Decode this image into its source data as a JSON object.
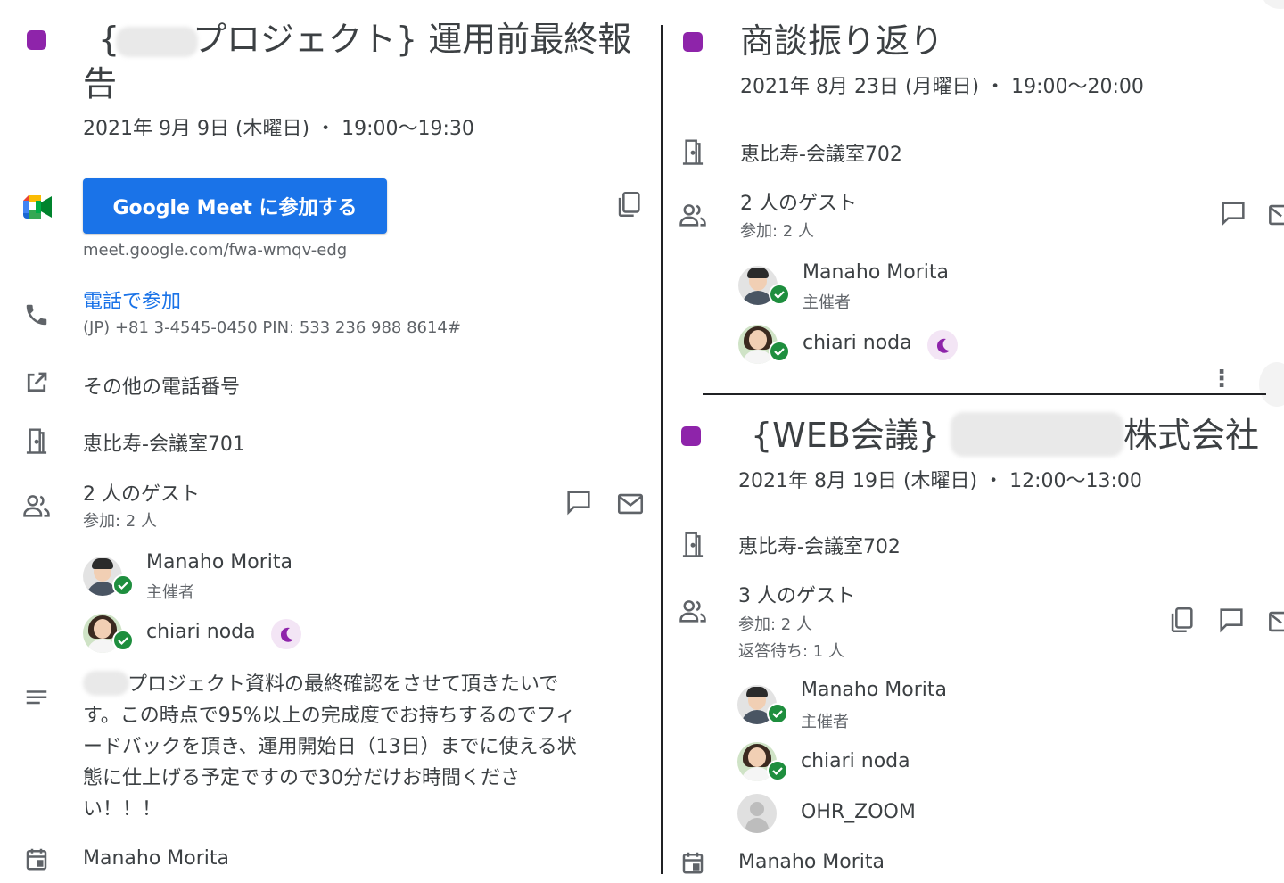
{
  "left": {
    "title_part1": "{",
    "title_part2": "プロジェクト} 運用前最終報",
    "title_line2": "告",
    "date": "2021年 9月 9日 (木曜日) ・ 19:00～19:30",
    "meet_button": "Google Meet に参加する",
    "meet_url": "meet.google.com/fwa-wmqv-edg",
    "phone_join": "電話で参加",
    "phone_number": "(JP) +81 3-4545-0450 PIN: 533 236 988 8614#",
    "other_numbers": "その他の電話番号",
    "room": "恵比寿-会議室701",
    "guests_title": "2 人のゲスト",
    "guests_sub": "参加: 2 人",
    "guests": [
      {
        "name": "Manaho Morita",
        "role": "主催者"
      },
      {
        "name": "chiari noda",
        "role": ""
      }
    ],
    "description_lines": [
      "プロジェクト資料の最終確認をさせて頂きたいで",
      "す。この時点で95%以上の完成度でお持ちするのでフィ",
      "ードバックを頂き、運用開始日（13日）までに使える状",
      "態に仕上げる予定ですので30分だけお時間くださ",
      "い！！！"
    ],
    "calendar_owner": "Manaho Morita"
  },
  "right_top": {
    "title": "商談振り返り",
    "date": "2021年 8月 23日 (月曜日) ・ 19:00～20:00",
    "room": "恵比寿-会議室702",
    "guests_title": "2 人のゲスト",
    "guests_sub": "参加: 2 人",
    "guests": [
      {
        "name": "Manaho Morita",
        "role": "主催者"
      },
      {
        "name": "chiari noda",
        "role": ""
      }
    ]
  },
  "right_bottom": {
    "title_part1": "{WEB会議}",
    "title_part2": "株式会社",
    "date": "2021年 8月 19日 (木曜日) ・ 12:00～13:00",
    "room": "恵比寿-会議室702",
    "guests_title": "3 人のゲスト",
    "guests_sub1": "参加: 2 人",
    "guests_sub2": "返答待ち: 1 人",
    "guests": [
      {
        "name": "Manaho Morita",
        "role": "主催者"
      },
      {
        "name": "chiari noda",
        "role": ""
      },
      {
        "name": "OHR_ZOOM",
        "role": ""
      }
    ],
    "calendar_owner": "Manaho Morita"
  },
  "colors": {
    "event_color": "#8e24aa",
    "meet_blue": "#1a73e8",
    "accepted_green": "#1e8e3e"
  },
  "icons": [
    "google-meet-icon",
    "copy-icon",
    "phone-icon",
    "open-in-new-icon",
    "room-door-icon",
    "people-icon",
    "chat-icon",
    "mail-icon",
    "moon-icon",
    "description-icon",
    "calendar-icon",
    "more-vert-icon"
  ]
}
